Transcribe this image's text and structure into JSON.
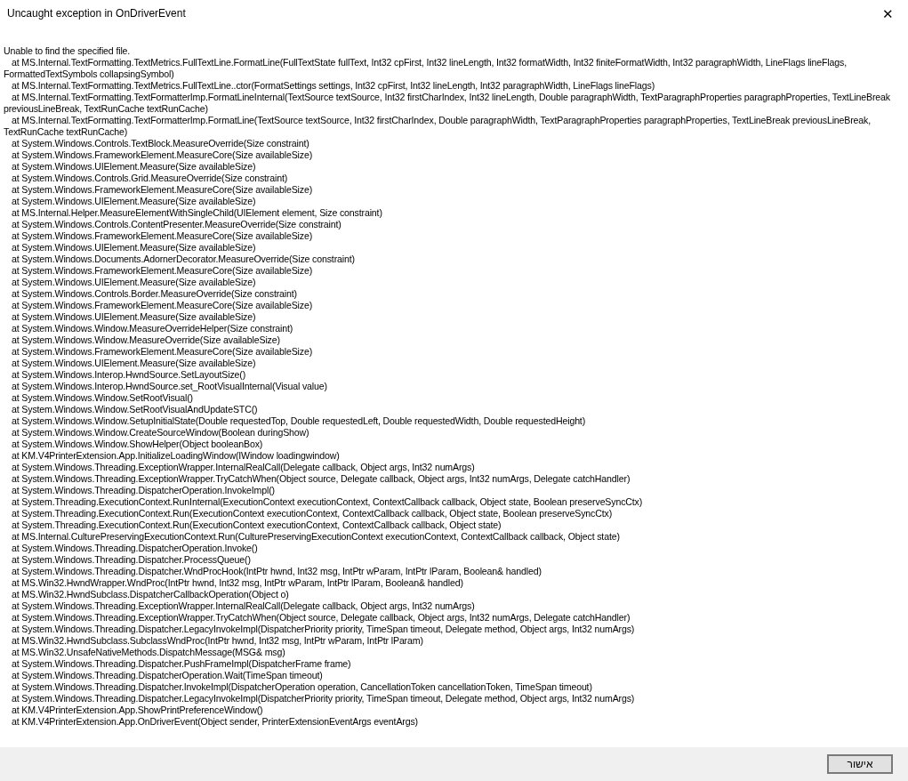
{
  "window": {
    "title": "Uncaught exception in OnDriverEvent",
    "close": "✕"
  },
  "message": "Unable to find the specified file.",
  "stack_trace": [
    "at MS.Internal.TextFormatting.TextMetrics.FullTextLine.FormatLine(FullTextState fullText, Int32 cpFirst, Int32 lineLength, Int32 formatWidth, Int32 finiteFormatWidth, Int32 paragraphWidth, LineFlags lineFlags, FormattedTextSymbols collapsingSymbol)",
    "at MS.Internal.TextFormatting.TextMetrics.FullTextLine..ctor(FormatSettings settings, Int32 cpFirst, Int32 lineLength, Int32 paragraphWidth, LineFlags lineFlags)",
    "at MS.Internal.TextFormatting.TextFormatterImp.FormatLineInternal(TextSource textSource, Int32 firstCharIndex, Int32 lineLength, Double paragraphWidth, TextParagraphProperties paragraphProperties, TextLineBreak previousLineBreak, TextRunCache textRunCache)",
    "at MS.Internal.TextFormatting.TextFormatterImp.FormatLine(TextSource textSource, Int32 firstCharIndex, Double paragraphWidth, TextParagraphProperties paragraphProperties, TextLineBreak previousLineBreak, TextRunCache textRunCache)",
    "at System.Windows.Controls.TextBlock.MeasureOverride(Size constraint)",
    "at System.Windows.FrameworkElement.MeasureCore(Size availableSize)",
    "at System.Windows.UIElement.Measure(Size availableSize)",
    "at System.Windows.Controls.Grid.MeasureOverride(Size constraint)",
    "at System.Windows.FrameworkElement.MeasureCore(Size availableSize)",
    "at System.Windows.UIElement.Measure(Size availableSize)",
    "at MS.Internal.Helper.MeasureElementWithSingleChild(UIElement element, Size constraint)",
    "at System.Windows.Controls.ContentPresenter.MeasureOverride(Size constraint)",
    "at System.Windows.FrameworkElement.MeasureCore(Size availableSize)",
    "at System.Windows.UIElement.Measure(Size availableSize)",
    "at System.Windows.Documents.AdornerDecorator.MeasureOverride(Size constraint)",
    "at System.Windows.FrameworkElement.MeasureCore(Size availableSize)",
    "at System.Windows.UIElement.Measure(Size availableSize)",
    "at System.Windows.Controls.Border.MeasureOverride(Size constraint)",
    "at System.Windows.FrameworkElement.MeasureCore(Size availableSize)",
    "at System.Windows.UIElement.Measure(Size availableSize)",
    "at System.Windows.Window.MeasureOverrideHelper(Size constraint)",
    "at System.Windows.Window.MeasureOverride(Size availableSize)",
    "at System.Windows.FrameworkElement.MeasureCore(Size availableSize)",
    "at System.Windows.UIElement.Measure(Size availableSize)",
    "at System.Windows.Interop.HwndSource.SetLayoutSize()",
    "at System.Windows.Interop.HwndSource.set_RootVisualInternal(Visual value)",
    "at System.Windows.Window.SetRootVisual()",
    "at System.Windows.Window.SetRootVisualAndUpdateSTC()",
    "at System.Windows.Window.SetupInitialState(Double requestedTop, Double requestedLeft, Double requestedWidth, Double requestedHeight)",
    "at System.Windows.Window.CreateSourceWindow(Boolean duringShow)",
    "at System.Windows.Window.ShowHelper(Object booleanBox)",
    "at KM.V4PrinterExtension.App.InitializeLoadingWindow(IWindow loadingwindow)",
    "at System.Windows.Threading.ExceptionWrapper.InternalRealCall(Delegate callback, Object args, Int32 numArgs)",
    "at System.Windows.Threading.ExceptionWrapper.TryCatchWhen(Object source, Delegate callback, Object args, Int32 numArgs, Delegate catchHandler)",
    "at System.Windows.Threading.DispatcherOperation.InvokeImpl()",
    "at System.Threading.ExecutionContext.RunInternal(ExecutionContext executionContext, ContextCallback callback, Object state, Boolean preserveSyncCtx)",
    "at System.Threading.ExecutionContext.Run(ExecutionContext executionContext, ContextCallback callback, Object state, Boolean preserveSyncCtx)",
    "at System.Threading.ExecutionContext.Run(ExecutionContext executionContext, ContextCallback callback, Object state)",
    "at MS.Internal.CulturePreservingExecutionContext.Run(CulturePreservingExecutionContext executionContext, ContextCallback callback, Object state)",
    "at System.Windows.Threading.DispatcherOperation.Invoke()",
    "at System.Windows.Threading.Dispatcher.ProcessQueue()",
    "at System.Windows.Threading.Dispatcher.WndProcHook(IntPtr hwnd, Int32 msg, IntPtr wParam, IntPtr lParam, Boolean& handled)",
    "at MS.Win32.HwndWrapper.WndProc(IntPtr hwnd, Int32 msg, IntPtr wParam, IntPtr lParam, Boolean& handled)",
    "at MS.Win32.HwndSubclass.DispatcherCallbackOperation(Object o)",
    "at System.Windows.Threading.ExceptionWrapper.InternalRealCall(Delegate callback, Object args, Int32 numArgs)",
    "at System.Windows.Threading.ExceptionWrapper.TryCatchWhen(Object source, Delegate callback, Object args, Int32 numArgs, Delegate catchHandler)",
    "at System.Windows.Threading.Dispatcher.LegacyInvokeImpl(DispatcherPriority priority, TimeSpan timeout, Delegate method, Object args, Int32 numArgs)",
    "at MS.Win32.HwndSubclass.SubclassWndProc(IntPtr hwnd, Int32 msg, IntPtr wParam, IntPtr lParam)",
    "at MS.Win32.UnsafeNativeMethods.DispatchMessage(MSG& msg)",
    "at System.Windows.Threading.Dispatcher.PushFrameImpl(DispatcherFrame frame)",
    "at System.Windows.Threading.DispatcherOperation.Wait(TimeSpan timeout)",
    "at System.Windows.Threading.Dispatcher.InvokeImpl(DispatcherOperation operation, CancellationToken cancellationToken, TimeSpan timeout)",
    "at System.Windows.Threading.Dispatcher.LegacyInvokeImpl(DispatcherPriority priority, TimeSpan timeout, Delegate method, Object args, Int32 numArgs)",
    "at KM.V4PrinterExtension.App.ShowPrintPreferenceWindow()",
    "at KM.V4PrinterExtension.App.OnDriverEvent(Object sender, PrinterExtensionEventArgs eventArgs)"
  ],
  "buttons": [
    "אישור"
  ]
}
